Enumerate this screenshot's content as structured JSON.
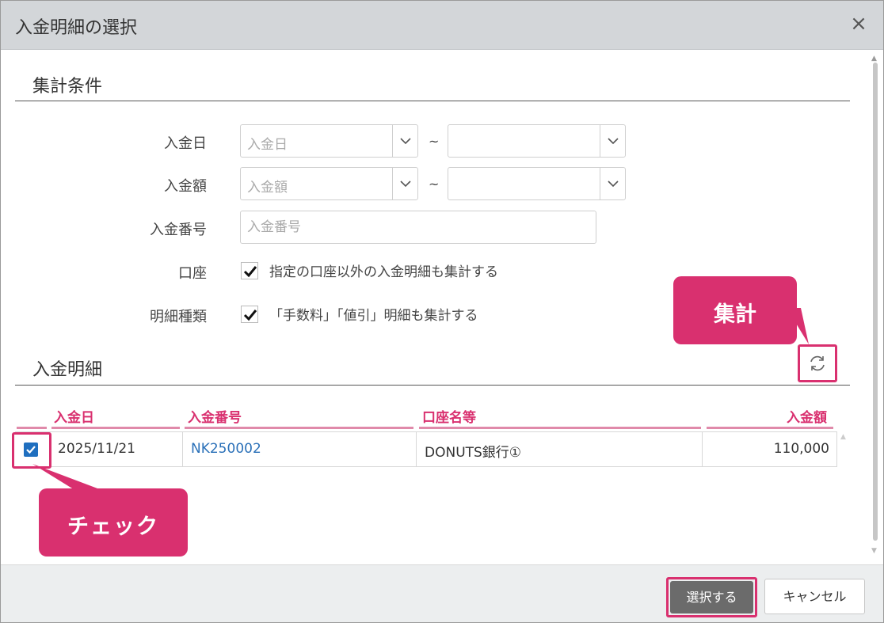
{
  "window": {
    "title": "入金明細の選択",
    "close_glyph": "×"
  },
  "criteria": {
    "title": "集計条件",
    "deposit_date": {
      "label": "入金日",
      "from_placeholder": "入金日",
      "to_value": "",
      "separator": "~"
    },
    "deposit_amount": {
      "label": "入金額",
      "from_placeholder": "入金額",
      "to_value": "",
      "separator": "~"
    },
    "deposit_number": {
      "label": "入金番号",
      "placeholder": "入金番号"
    },
    "account": {
      "label": "口座",
      "checkbox_label": "指定の口座以外の入金明細も集計する",
      "checked": true
    },
    "detail_type": {
      "label": "明細種類",
      "checkbox_label": "「手数料」「値引」明細も集計する",
      "checked": true
    }
  },
  "details": {
    "title": "入金明細",
    "refresh_icon": "refresh-icon",
    "columns": [
      "入金日",
      "入金番号",
      "口座名等",
      "入金額"
    ],
    "rows": [
      {
        "checked": true,
        "date": "2025/11/21",
        "number": "NK250002",
        "account": "DONUTS銀行①",
        "amount": "110,000"
      }
    ]
  },
  "callouts": {
    "aggregate": "集計",
    "check": "チェック"
  },
  "footer": {
    "select_label": "選択する",
    "cancel_label": "キャンセル"
  },
  "colors": {
    "accent": "#d9306f",
    "link": "#2a70b8",
    "primary_button": "#6b6b6b",
    "titlebar": "#d3d6d9"
  }
}
